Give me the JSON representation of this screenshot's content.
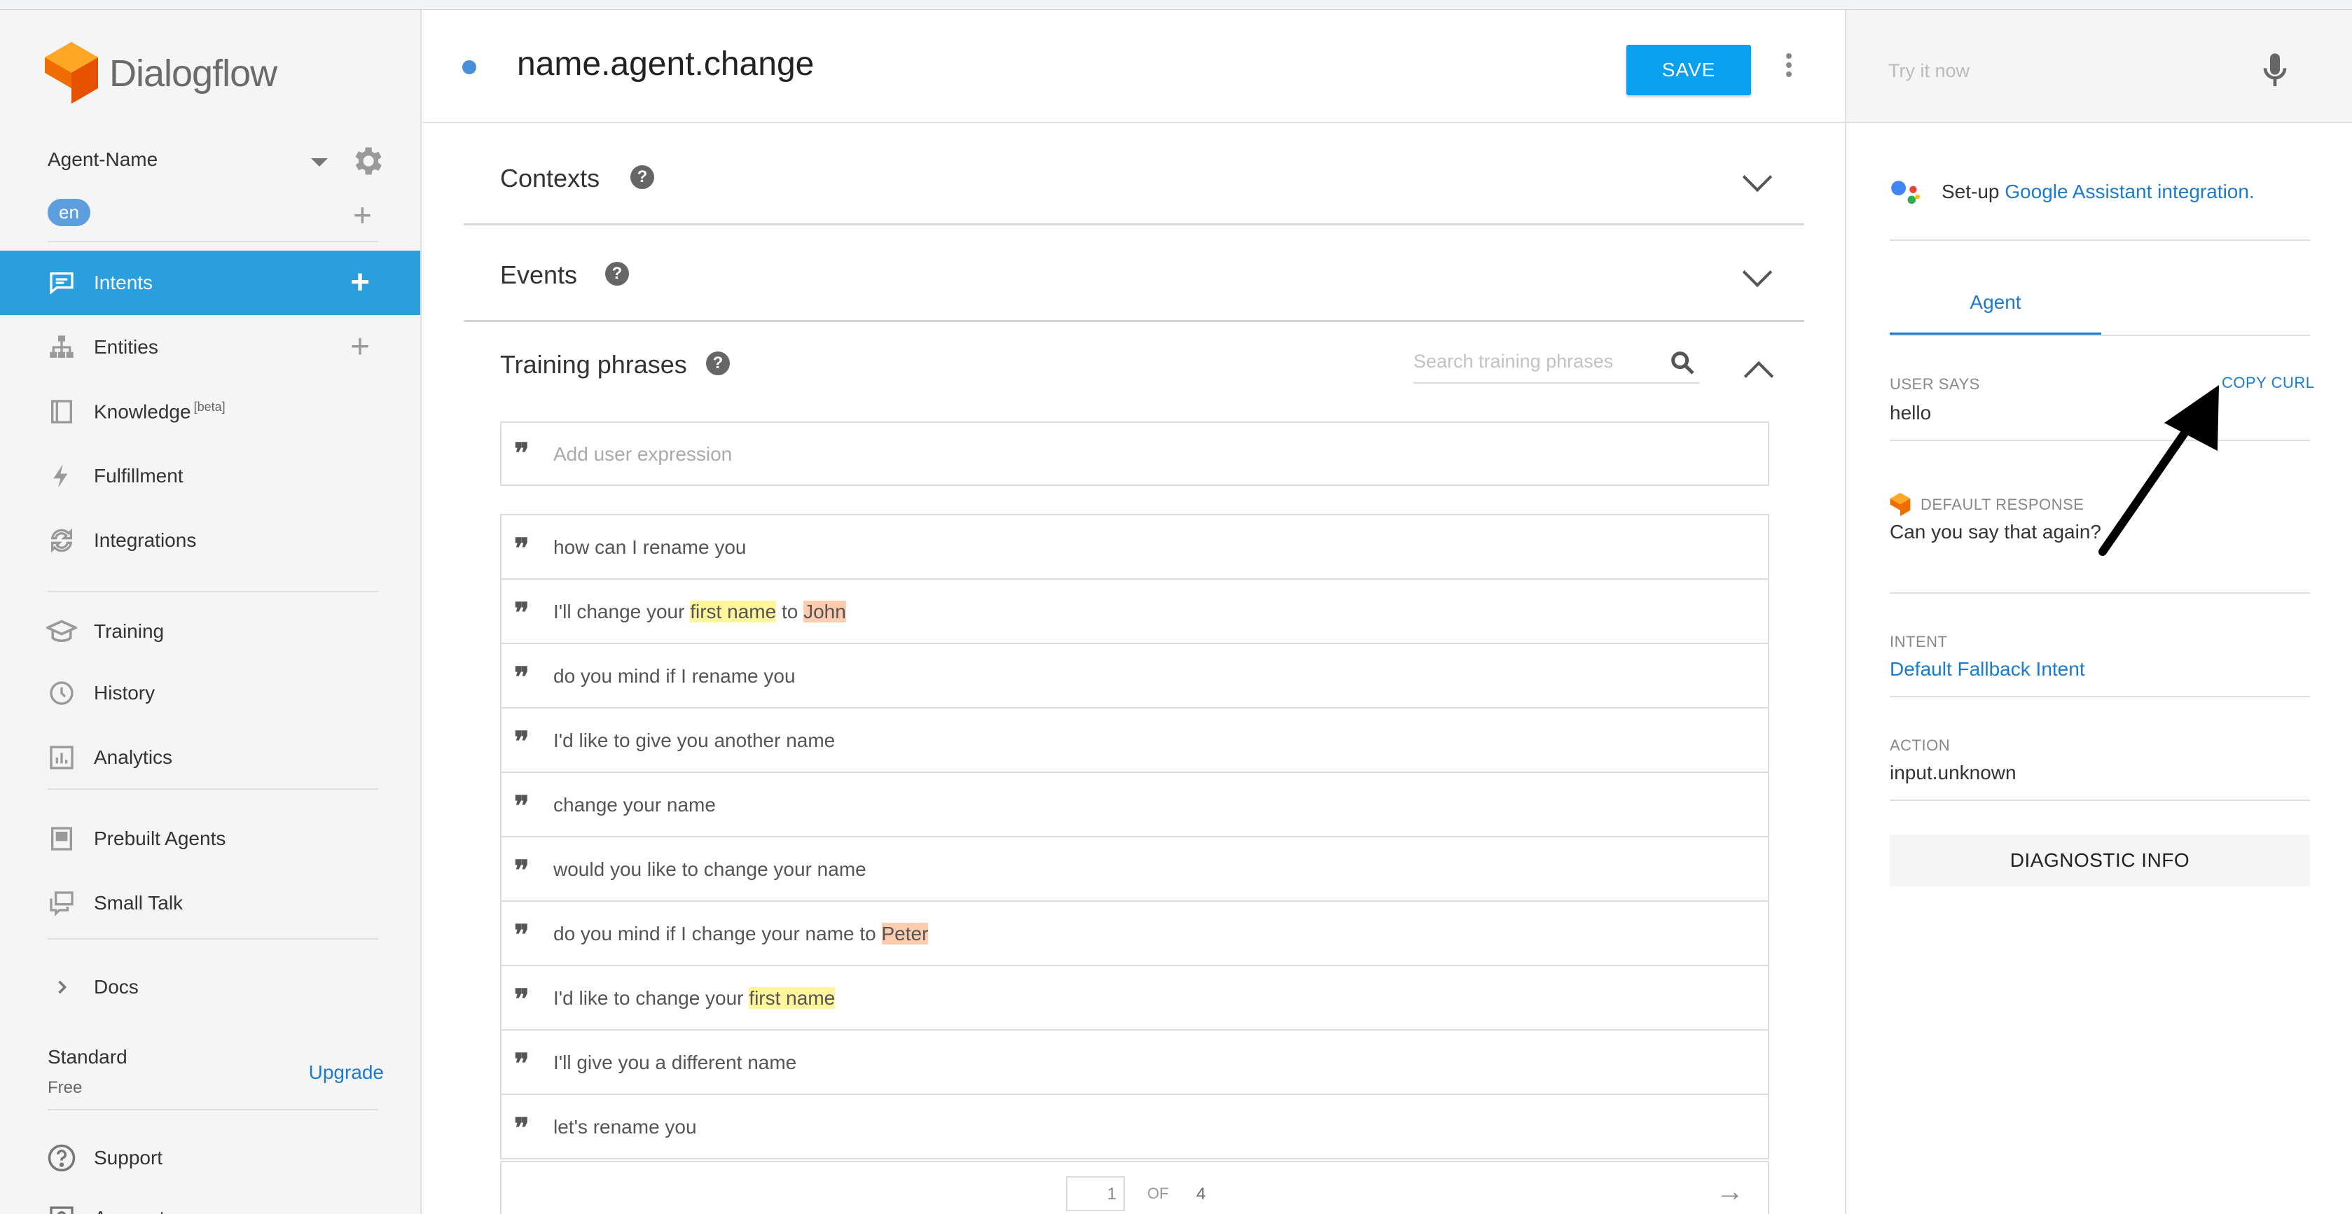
{
  "app": {
    "logo_text": "Dialogflow"
  },
  "sidebar": {
    "agent_name": "Agent-Name",
    "language": "en",
    "items": [
      {
        "label": "Intents",
        "icon": "intents-icon",
        "active": true
      },
      {
        "label": "Entities",
        "icon": "entities-icon"
      },
      {
        "label": "Knowledge",
        "icon": "knowledge-icon",
        "badge": "[beta]"
      },
      {
        "label": "Fulfillment",
        "icon": "fulfillment-icon"
      },
      {
        "label": "Integrations",
        "icon": "integrations-icon"
      },
      {
        "label": "Training",
        "icon": "training-icon"
      },
      {
        "label": "History",
        "icon": "history-icon"
      },
      {
        "label": "Analytics",
        "icon": "analytics-icon"
      },
      {
        "label": "Prebuilt Agents",
        "icon": "prebuilt-agents-icon"
      },
      {
        "label": "Small Talk",
        "icon": "small-talk-icon"
      },
      {
        "label": "Docs",
        "icon": "chevron-right-icon"
      },
      {
        "label": "Support",
        "icon": "help-circle-icon"
      },
      {
        "label": "Account",
        "icon": "account-icon"
      }
    ],
    "plan": {
      "name": "Standard",
      "tier": "Free",
      "upgrade_label": "Upgrade"
    }
  },
  "main": {
    "intent_name": "name.agent.change",
    "save_label": "SAVE",
    "sections": {
      "contexts": "Contexts",
      "events": "Events",
      "training_phrases": "Training phrases"
    },
    "search_placeholder": "Search training phrases",
    "add_expression_placeholder": "Add user expression",
    "phrases": [
      [
        {
          "t": "how can I rename you"
        }
      ],
      [
        {
          "t": "I'll change your "
        },
        {
          "t": "first name",
          "hl": "y"
        },
        {
          "t": " to "
        },
        {
          "t": "John",
          "hl": "o"
        }
      ],
      [
        {
          "t": "do you mind if I rename you"
        }
      ],
      [
        {
          "t": "I'd like to give you another name"
        }
      ],
      [
        {
          "t": "change your name"
        }
      ],
      [
        {
          "t": "would you like to change your name"
        }
      ],
      [
        {
          "t": "do you mind if I change your name to "
        },
        {
          "t": "Peter",
          "hl": "o"
        }
      ],
      [
        {
          "t": "I'd like to change your "
        },
        {
          "t": "first name",
          "hl": "y"
        }
      ],
      [
        {
          "t": "I'll give you a different name"
        }
      ],
      [
        {
          "t": "let's rename you"
        }
      ]
    ],
    "pagination": {
      "current": "1",
      "of_label": "OF",
      "total": "4"
    }
  },
  "right_panel": {
    "try_placeholder": "Try it now",
    "assistant_prefix": "Set-up ",
    "assistant_link": "Google Assistant integration.",
    "tab_agent": "Agent",
    "user_says_label": "USER SAYS",
    "copy_curl_label": "COPY CURL",
    "user_says_value": "hello",
    "default_response_label": "DEFAULT RESPONSE",
    "default_response_value": "Can you say that again?",
    "intent_label": "INTENT",
    "intent_value": "Default Fallback Intent",
    "action_label": "ACTION",
    "action_value": "input.unknown",
    "diagnostic_label": "DIAGNOSTIC INFO"
  },
  "colors": {
    "accent": "#2b9ede",
    "save_button": "#0aa0f0",
    "link": "#1a7bd0",
    "entity_yellow": "#fff59d",
    "entity_orange": "#ffccb0"
  }
}
